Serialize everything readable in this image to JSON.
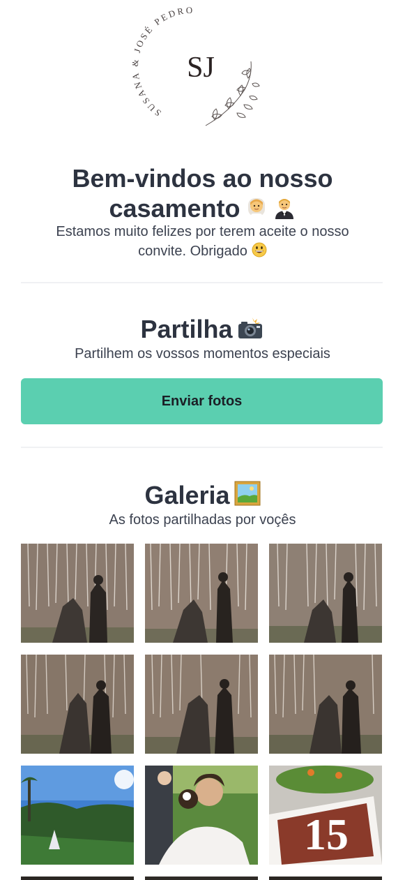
{
  "header": {
    "logo_initials": "SJ",
    "logo_names": "SUSANA & JOSÉ PEDRO"
  },
  "welcome": {
    "title_line1": "Bem-vindos ao nosso",
    "title_line2": "casamento",
    "subtitle_line1": "Estamos muito felizes por terem aceite o nosso",
    "subtitle_line2": "convite. Obrigado",
    "icons": [
      "bride-emoji-icon",
      "groom-emoji-icon",
      "smile-emoji-icon"
    ]
  },
  "share": {
    "title": "Partilha",
    "subtitle": "Partilhem os vossos momentos especiais",
    "button_label": "Enviar fotos",
    "icon": "camera-flash-emoji-icon",
    "button_color": "#5bcfb0"
  },
  "gallery": {
    "title": "Galeria",
    "subtitle": "As fotos partilhadas por voçês",
    "icon": "framed-picture-emoji-icon",
    "photos": [
      {
        "name": "photo-cake-cutting-sparklers-1"
      },
      {
        "name": "photo-cake-cutting-sparklers-2"
      },
      {
        "name": "photo-cake-cutting-sparklers-3"
      },
      {
        "name": "photo-cake-cutting-sparklers-4"
      },
      {
        "name": "photo-cake-cutting-sparklers-5"
      },
      {
        "name": "photo-cake-cutting-sparklers-6"
      },
      {
        "name": "photo-garden-party"
      },
      {
        "name": "photo-bride-hug"
      },
      {
        "name": "photo-number-15-table"
      }
    ]
  }
}
